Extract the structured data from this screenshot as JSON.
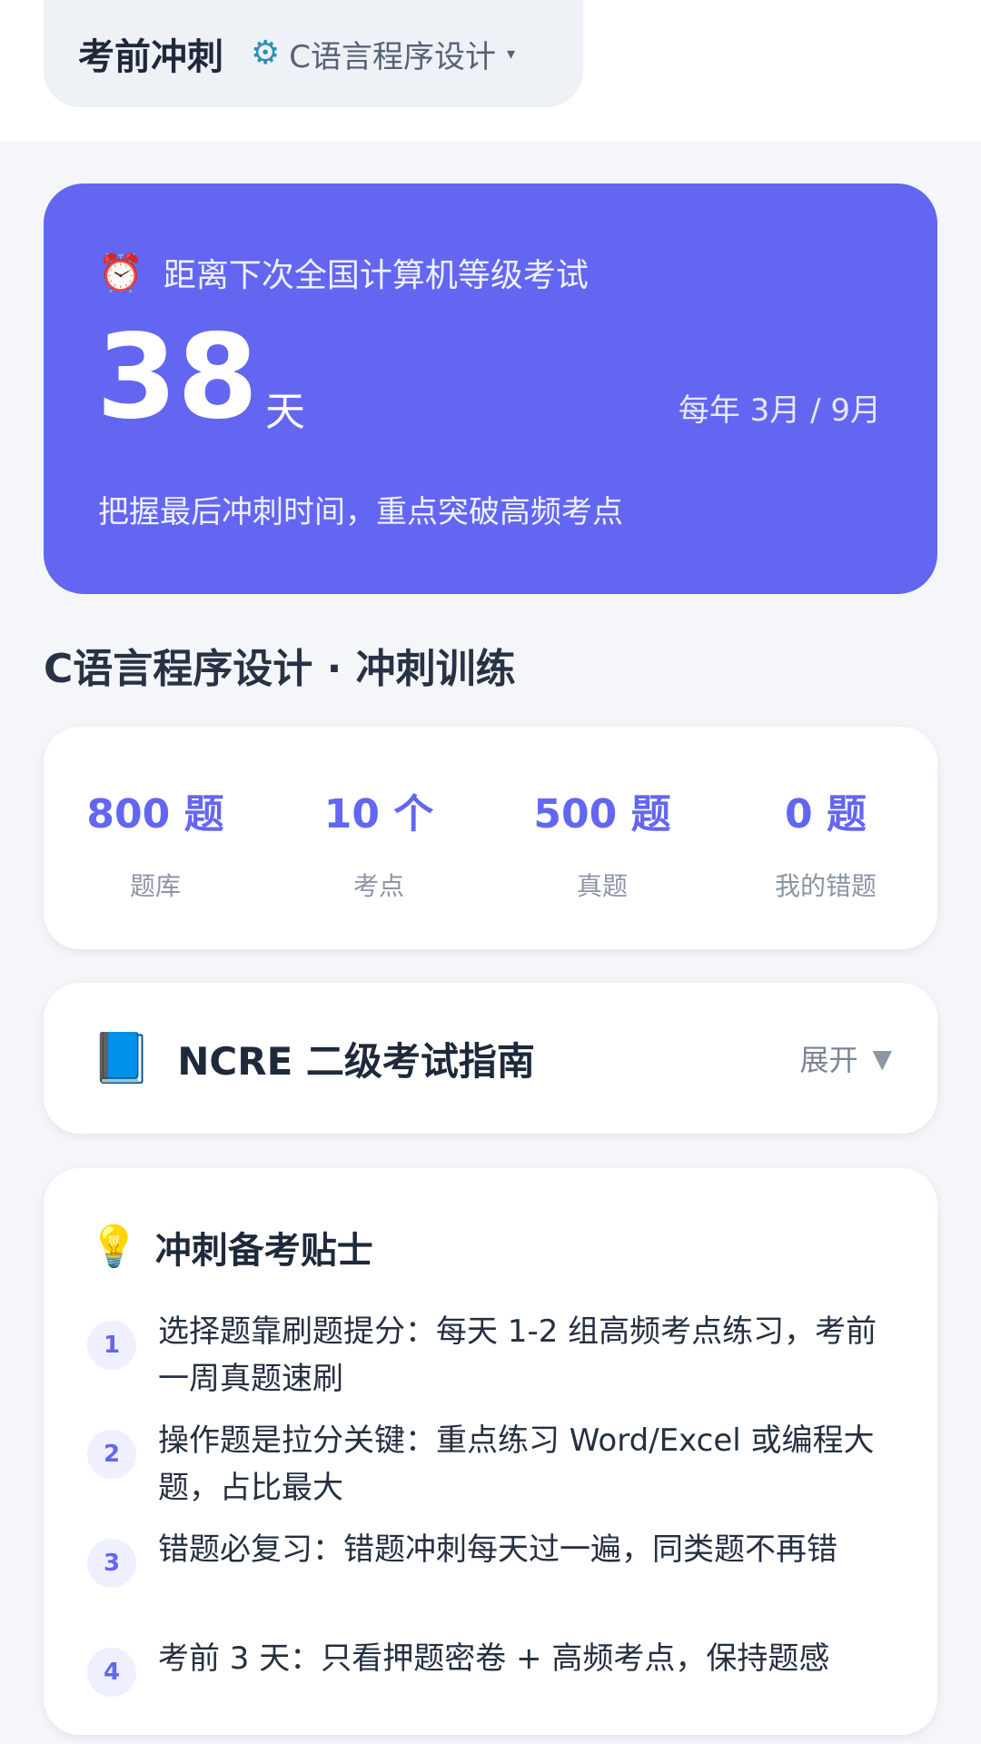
{
  "header": {
    "title": "考前冲刺",
    "gear_icon": "gear-icon",
    "subject": "C语言程序设计",
    "caret": "▾"
  },
  "countdown": {
    "icon": "⏰",
    "label": "距离下次全国计算机等级考试",
    "days": "38",
    "unit": "天",
    "schedule": "每年 3月 / 9月",
    "motto": "把握最后冲刺时间，重点突破高频考点"
  },
  "section": {
    "title": "C语言程序设计 · 冲刺训练"
  },
  "stats": [
    {
      "value": "800 题",
      "label": "题库"
    },
    {
      "value": "10 个",
      "label": "考点"
    },
    {
      "value": "500 题",
      "label": "真题"
    },
    {
      "value": "0 题",
      "label": "我的错题"
    }
  ],
  "guide": {
    "icon": "📘",
    "title": "NCRE 二级考试指南",
    "expand_label": "展开",
    "expand_icon": "▼"
  },
  "tips": {
    "icon": "💡",
    "title": "冲刺备考贴士",
    "items": [
      {
        "num": "1",
        "text": "选择题靠刷题提分：每天 1-2 组高频考点练习，考前一周真题速刷"
      },
      {
        "num": "2",
        "text": "操作题是拉分关键：重点练习 Word/Excel 或编程大题，占比最大"
      },
      {
        "num": "3",
        "text": "错题必复习：错题冲刺每天过一遍，同类题不再错"
      },
      {
        "num": "4",
        "text": "考前 3 天：只看押题密卷 + 高频考点，保持题感"
      }
    ]
  },
  "colors": {
    "accent": "#6366f1",
    "page_bg": "#f4f6fa"
  }
}
